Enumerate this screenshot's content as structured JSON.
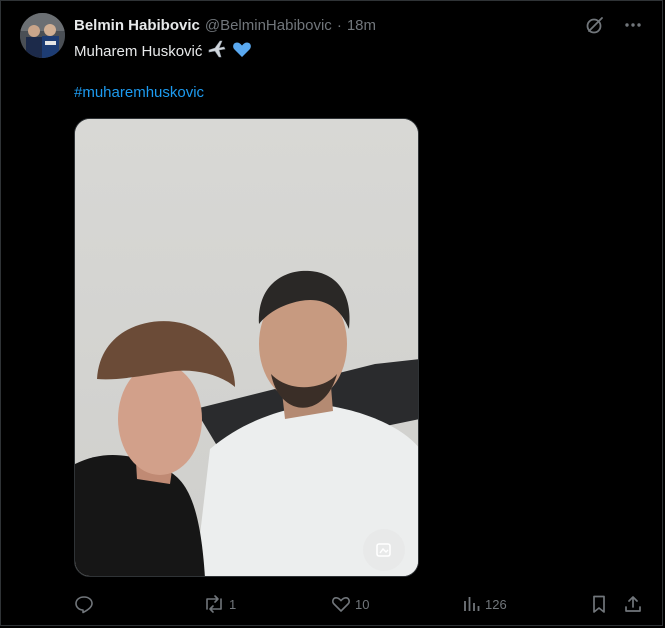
{
  "tweet": {
    "author_name": "Belmin Habibovic",
    "author_handle": "@BelminHabibovic",
    "separator": "·",
    "time": "18m",
    "text": "Muharem Husković",
    "emojis": [
      "airplane",
      "blue-heart"
    ],
    "hashtag": "#muharemhuskovic"
  },
  "actions": {
    "reply_count": "",
    "retweet_count": "1",
    "like_count": "10",
    "views_count": "126"
  },
  "colors": {
    "background": "#000000",
    "text": "#e7e9ea",
    "muted": "#71767b",
    "link": "#1d9bf0",
    "heart": "#5aa9f0"
  }
}
